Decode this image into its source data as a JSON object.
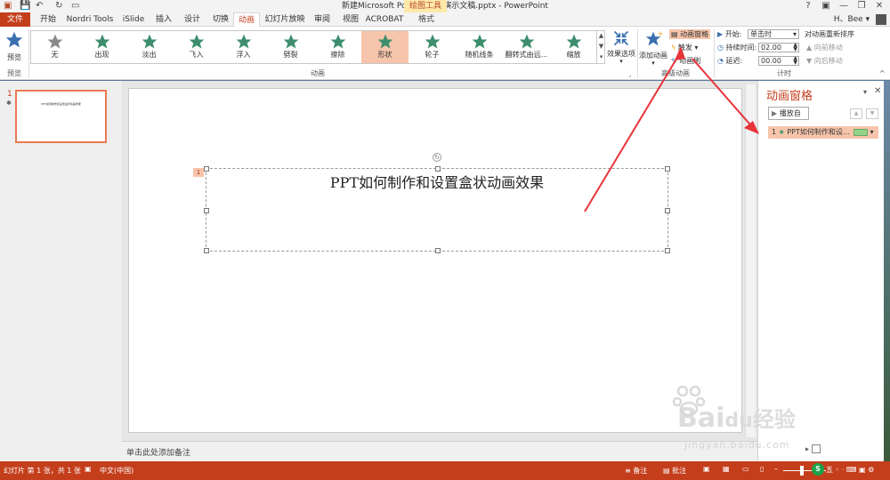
{
  "titlebar": {
    "title": "新建Microsoft PowerPoint 演示文稿.pptx - PowerPoint",
    "contextual_tab": "绘图工具",
    "help": "?",
    "minimize": "—",
    "restore": "❐",
    "close": "✕"
  },
  "tabs": {
    "file": "文件",
    "home": "开始",
    "nordri": "Nordri Tools",
    "islide": "iSlide",
    "insert": "插入",
    "design": "设计",
    "transitions": "切换",
    "animations": "动画",
    "slideshow": "幻灯片放映",
    "review": "审阅",
    "view": "视图",
    "acrobat": "ACROBAT",
    "format": "格式",
    "user": "H、Bee"
  },
  "ribbon": {
    "preview_label": "预览",
    "preview_group": "预览",
    "animation_group": "动画",
    "advanced_group": "高级动画",
    "timing_group": "计时",
    "effect_options": "效果选项",
    "add_animation": "添加动画",
    "animation_pane_btn": "动画窗格",
    "trigger_btn": "触发",
    "animation_painter_btn": "动画刷",
    "start_label": "开始:",
    "start_value": "单击时",
    "duration_label": "持续时间:",
    "duration_value": "02.00",
    "delay_label": "延迟:",
    "delay_value": "00.00",
    "reorder_title": "对动画重新排序",
    "move_earlier": "向前移动",
    "move_later": "向后移动",
    "animations": [
      {
        "label": "无",
        "color": "#8a8a8a"
      },
      {
        "label": "出现",
        "color": "#3e8e6e"
      },
      {
        "label": "淡出",
        "color": "#3e8e6e"
      },
      {
        "label": "飞入",
        "color": "#3e8e6e"
      },
      {
        "label": "浮入",
        "color": "#3e8e6e"
      },
      {
        "label": "劈裂",
        "color": "#3e8e6e"
      },
      {
        "label": "擦除",
        "color": "#3e8e6e"
      },
      {
        "label": "形状",
        "color": "#3e8e6e"
      },
      {
        "label": "轮子",
        "color": "#3e8e6e"
      },
      {
        "label": "随机线条",
        "color": "#3e8e6e"
      },
      {
        "label": "翻转式由远...",
        "color": "#3e8e6e"
      },
      {
        "label": "缩放",
        "color": "#3e8e6e"
      }
    ]
  },
  "thumbnail": {
    "number": "1",
    "text": "PPT如何制作和设置盒状动画效果"
  },
  "slide": {
    "tag": "1",
    "title_text": "PPT如何制作和设置盒状动画效果"
  },
  "notes": {
    "placeholder": "单击此处添加备注"
  },
  "anim_pane": {
    "title": "动画窗格",
    "play_btn": "播放自",
    "item_number": "1",
    "item_label": "PPT如何制作和设..."
  },
  "status": {
    "slide_info": "幻灯片 第 1 张，共 1 张",
    "language": "中文(中国)",
    "notes": "备注",
    "comments": "批注"
  },
  "watermark": {
    "text1": "Bai",
    "text2": "du",
    "text3": "经验",
    "url": "jingyan.baidu.com"
  },
  "colors": {
    "accent": "#c43e1c",
    "selected": "#f7c5ab",
    "green_star": "#3e8e6e",
    "annotation_red": "#e8333a"
  }
}
